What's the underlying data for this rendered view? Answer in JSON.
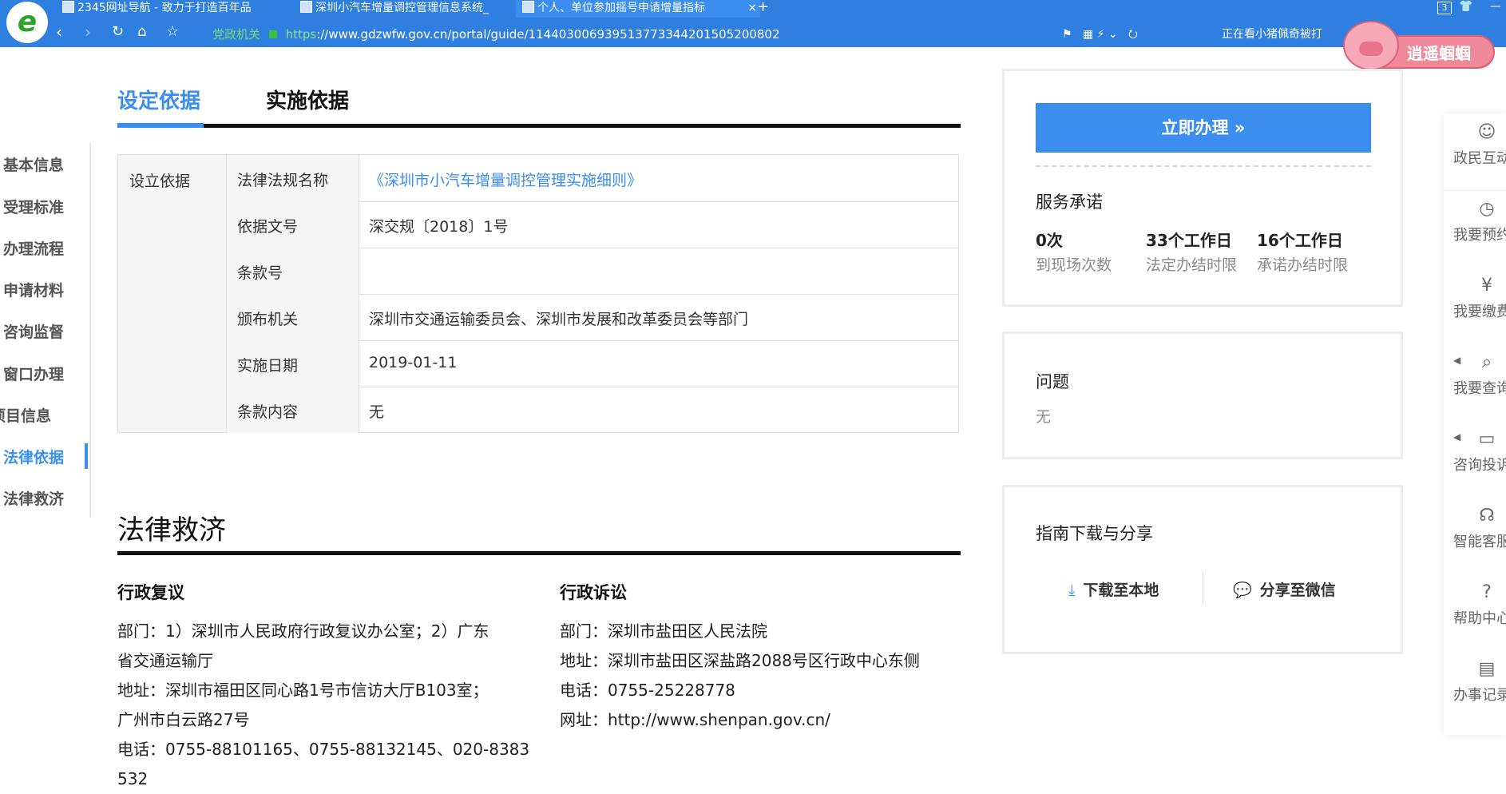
{
  "browser": {
    "tabs": [
      {
        "title": "2345网址导航 - 致力于打造百年品"
      },
      {
        "title": "深圳小汽车增量调控管理信息系统_"
      },
      {
        "title": "个人、单位参加摇号申请增量指标"
      }
    ],
    "tab_close": "×",
    "new_tab": "+",
    "tab_count": "3",
    "url_badge": "党政机关",
    "url_scheme": "https",
    "url": "://www.gdzwfw.gov.cn/portal/guide/11440300693951377334420150520080​2",
    "news_ticker": "正在看小猪佩奇被打",
    "pig_name": "逍遥蝈蝈"
  },
  "leftnav": {
    "items": [
      {
        "label": "基本信息"
      },
      {
        "label": "受理标准"
      },
      {
        "label": "办理流程"
      },
      {
        "label": "申请材料"
      },
      {
        "label": "咨询监督"
      },
      {
        "label": "窗口办理"
      },
      {
        "label": "项目信息"
      },
      {
        "label": "法律依据"
      },
      {
        "label": "法律救济"
      }
    ],
    "active_index": 7
  },
  "main": {
    "tabs": [
      {
        "label": "设定依据"
      },
      {
        "label": "实施依据"
      }
    ],
    "basis_label": "设立依据",
    "basis_rows": [
      {
        "key": "法律法规名称",
        "value": "《深圳市小汽车增量调控管理实施细则》"
      },
      {
        "key": "依据文号",
        "value": "深交规〔2018〕1号"
      },
      {
        "key": "条款号",
        "value": ""
      },
      {
        "key": "颁布机关",
        "value": "深圳市交通运输委员会、深圳市发展和改革委员会等部门"
      },
      {
        "key": "实施日期",
        "value": "2019-01-11"
      },
      {
        "key": "条款内容",
        "value": "无"
      }
    ],
    "remedy_title": "法律救济",
    "review": {
      "title": "行政复议",
      "lines": [
        "部门：1）深圳市人民政府行政复议办公室；2）广东",
        "省交通运输厅",
        "地址：深圳市福田区同心路1号市信访大厅B103室；",
        "广州市白云路27号",
        "电话：0755-88101165、0755-88132145、020-8383",
        "532"
      ]
    },
    "litigation": {
      "title": "行政诉讼",
      "lines": [
        "部门：深圳市盐田区人民法院",
        "地址：深圳市盐田区深盐路2088号区行政中心东侧",
        "电话：0755-25228778",
        "网址：http://www.shenpan.gov.cn/"
      ]
    }
  },
  "right": {
    "do_button": "立即办理 »",
    "promise_title": "服务承诺",
    "stats": [
      {
        "value": "0次",
        "label": "到现场次数"
      },
      {
        "value": "33个工作日",
        "label": "法定办结时限"
      },
      {
        "value": "16个工作日",
        "label": "承诺办结时限"
      }
    ],
    "question_title": "问题",
    "question_value": "无",
    "download_title": "指南下载与分享",
    "download_label": "下载至本地",
    "share_label": "分享至微信"
  },
  "floatbar": {
    "items": [
      {
        "label": "政民互动",
        "icon": "chat-icon"
      },
      {
        "label": "我要预约",
        "icon": "clock-icon"
      },
      {
        "label": "我要缴费",
        "icon": "payment-icon"
      },
      {
        "label": "我要查询",
        "icon": "search-icon"
      },
      {
        "label": "咨询投诉",
        "icon": "complaint-icon"
      },
      {
        "label": "智能客服",
        "icon": "headset-icon"
      },
      {
        "label": "帮助中心",
        "icon": "help-icon"
      },
      {
        "label": "办事记录",
        "icon": "clipboard-icon"
      }
    ]
  },
  "colors": {
    "accent": "#3a8ef0",
    "chrome": "#2e7fe0"
  }
}
